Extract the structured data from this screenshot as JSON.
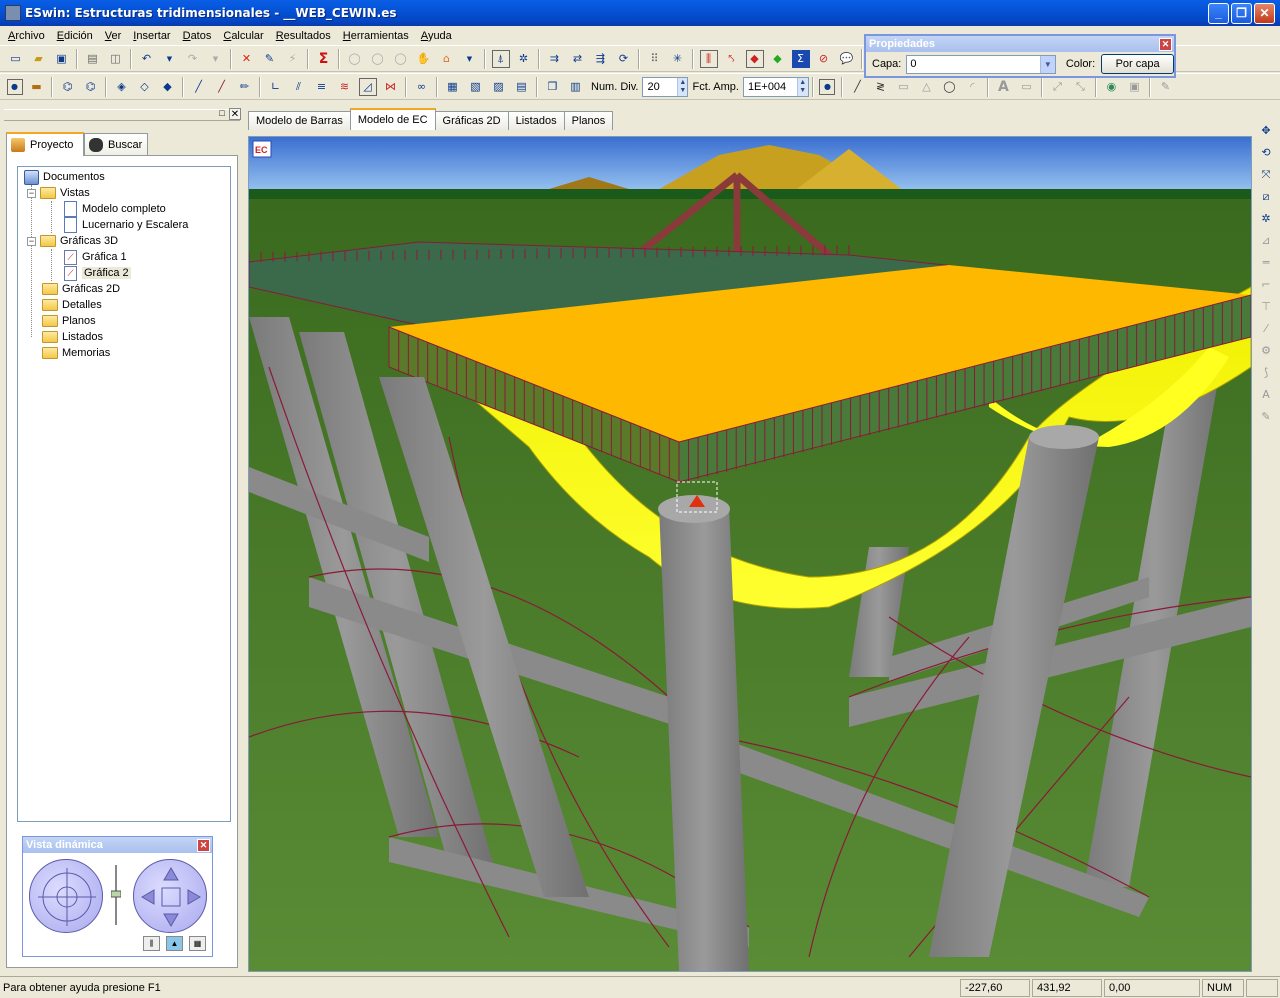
{
  "window": {
    "title": "ESwin: Estructuras tridimensionales - __WEB_CEWIN.es",
    "minimize": "_",
    "maximize": "❐",
    "close": "✕"
  },
  "menu": [
    "Archivo",
    "Edición",
    "Ver",
    "Insertar",
    "Datos",
    "Calcular",
    "Resultados",
    "Herramientas",
    "Ayuda"
  ],
  "toolbar": {
    "num_div_label": "Num. Div.",
    "num_div_value": "20",
    "fct_amp_label": "Fct. Amp.",
    "fct_amp_value": "1E+004",
    "sigma_icon": "Σ"
  },
  "properties": {
    "title": "Propiedades",
    "capa_label": "Capa:",
    "capa_value": "0",
    "color_label": "Color:",
    "color_button": "Por capa"
  },
  "left_tabs": [
    "Proyecto",
    "Buscar"
  ],
  "tree": {
    "root": "Documentos",
    "vistas": "Vistas",
    "modelo_completo": "Modelo completo",
    "lucernario": "Lucernario y Escalera",
    "graficas_3d": "Gráficas 3D",
    "grafica_1": "Gráfica 1",
    "grafica_2": "Gráfica 2",
    "graficas_2d": "Gráficas 2D",
    "detalles": "Detalles",
    "planos": "Planos",
    "listados": "Listados",
    "memorias": "Memorias"
  },
  "vista_dinamica": {
    "title": "Vista dinámica"
  },
  "doc_tabs": [
    "Modelo de Barras",
    "Modelo de EC",
    "Gráficas 2D",
    "Listados",
    "Planos"
  ],
  "viewport": {
    "badge": "EC"
  },
  "status": {
    "message": "Para obtener ayuda presione F1",
    "x": "-227,60",
    "y": "431,92",
    "z": "0,00",
    "num": "NUM"
  },
  "colors": {
    "title_bar": "#0553d6",
    "slab": "#ffb800",
    "deformed": "#ffff00",
    "column": "#8a8a8a",
    "ground": "#4d7d2e",
    "sky": "#5b8ce0"
  }
}
